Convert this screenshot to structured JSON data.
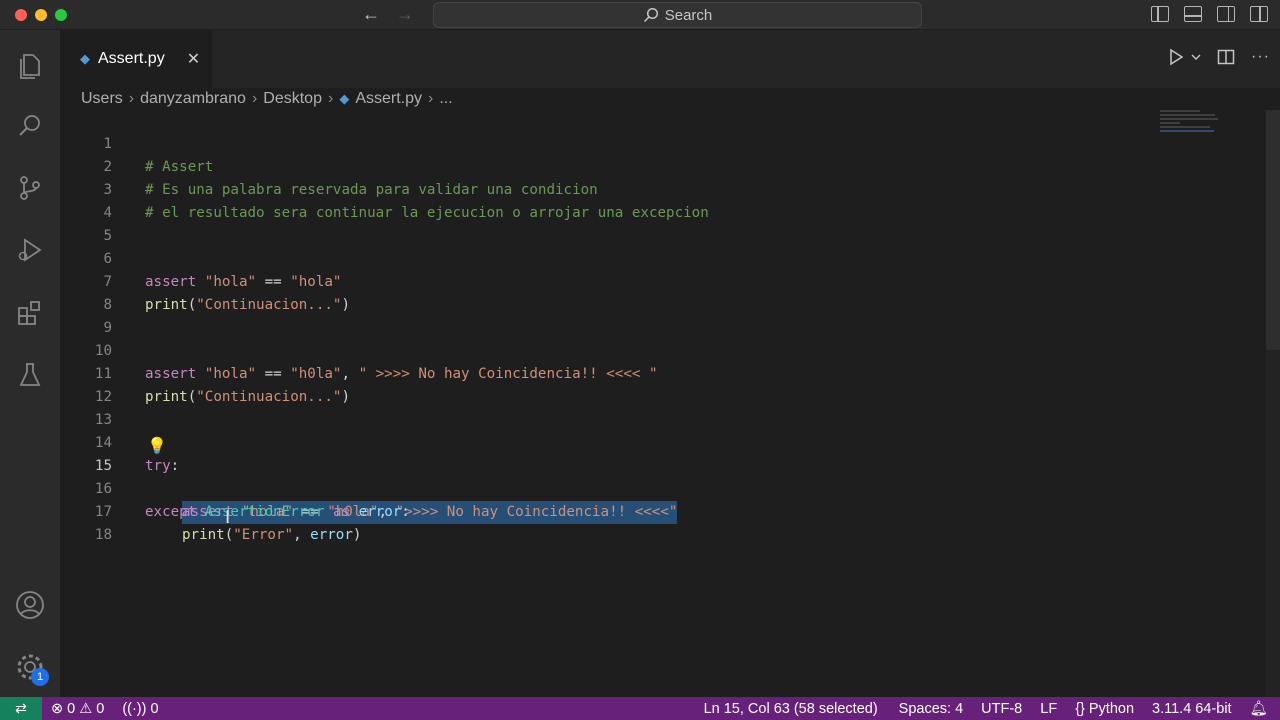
{
  "titlebar": {
    "search_label": "Search"
  },
  "tab": {
    "label": "Assert.py",
    "close": "✕"
  },
  "breadcrumb": {
    "items": [
      "Users",
      "danyzambrano",
      "Desktop",
      "Assert.py",
      "..."
    ]
  },
  "editor": {
    "lines": [
      {
        "n": "1",
        "text": "# Assert"
      },
      {
        "n": "2",
        "text": "# Es una palabra reservada para validar una condicion"
      },
      {
        "n": "3",
        "text": "# el resultado sera continuar la ejecucion o arrojar una excepcion"
      },
      {
        "n": "4",
        "text": ""
      },
      {
        "n": "5",
        "text": ""
      },
      {
        "n": "6",
        "text": "assert \"hola\" == \"hola\""
      },
      {
        "n": "7",
        "text": "print(\"Continuacion...\")"
      },
      {
        "n": "8",
        "text": ""
      },
      {
        "n": "9",
        "text": ""
      },
      {
        "n": "10",
        "text": "assert \"hola\" == \"h0la\", \" >>>> No hay Coincidencia!! <<<< \""
      },
      {
        "n": "11",
        "text": "print(\"Continuacion...\")"
      },
      {
        "n": "12",
        "text": ""
      },
      {
        "n": "13",
        "text": ""
      },
      {
        "n": "14",
        "text": "try:"
      },
      {
        "n": "15",
        "text": "assert \"hola\" == \"h0la\", \">>>> No hay Coincidencia!! <<<<\""
      },
      {
        "n": "16",
        "text": "except AssertionError as error:"
      },
      {
        "n": "17",
        "text": "print(\"Error\", error)"
      },
      {
        "n": "18",
        "text": ""
      }
    ],
    "active_line": "15"
  },
  "activity": {
    "badge": "1"
  },
  "statusbar": {
    "errors": "0",
    "warnings": "0",
    "ports": "0",
    "position": "Ln 15, Col 63 (58 selected)",
    "spaces": "Spaces: 4",
    "encoding": "UTF-8",
    "eol": "LF",
    "language": "Python",
    "interpreter": "3.11.4 64-bit"
  },
  "colors": {
    "statusbar": "#68217a",
    "remote": "#16825d",
    "selection": "#264f78",
    "comment": "#6a9955",
    "keyword": "#c586c0",
    "string": "#ce9178"
  }
}
